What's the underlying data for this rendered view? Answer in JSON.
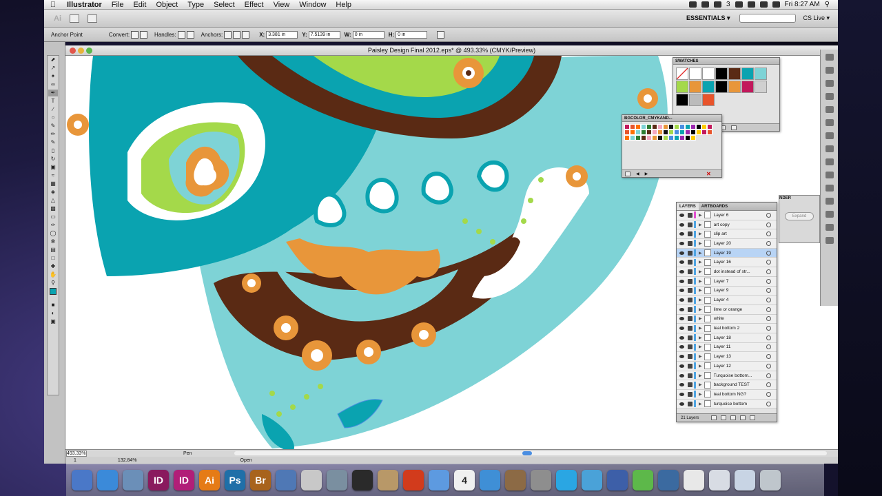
{
  "menubar": {
    "app_name": "Illustrator",
    "items": [
      "File",
      "Edit",
      "Object",
      "Type",
      "Select",
      "Effect",
      "View",
      "Window",
      "Help"
    ],
    "right": {
      "battery_label": "3",
      "clock": "Fri 8:27 AM"
    }
  },
  "appbar": {
    "logo": "Ai",
    "workspace": "ESSENTIALS ▾",
    "search_placeholder": "",
    "cs_live": "CS Live ▾"
  },
  "controlbar": {
    "mode_label": "Anchor Point",
    "convert_label": "Convert:",
    "handles_label": "Handles:",
    "anchors_label": "Anchors:",
    "x_label": "X:",
    "x_value": "3.381 in",
    "y_label": "Y:",
    "y_value": "7.5139 in",
    "w_label": "W:",
    "w_value": "0 in",
    "h_label": "H:",
    "h_value": "0 in"
  },
  "document": {
    "title": "Paisley Design Final 2012.eps* @ 493.33% (CMYK/Preview)",
    "zoom": "493.33%",
    "current_tool": "Pen",
    "bottom_zoom": "132.84%",
    "bottom_label": "Open",
    "page_number": "1"
  },
  "swatches_panel": {
    "title": "SWATCHES"
  },
  "bgcolor_panel": {
    "title": "BGCOLOR_CMYKAND..."
  },
  "behind_panel": {
    "tab_fragment": "NDER",
    "expand_label": "Expand"
  },
  "layers_panel": {
    "tabs": [
      "LAYERS",
      "ARTBOARDS"
    ],
    "layers": [
      {
        "name": "Layer 6",
        "color": "#e24fd0"
      },
      {
        "name": "art copy",
        "color": "#4fa4e2"
      },
      {
        "name": "clip art",
        "color": "#4fa4e2"
      },
      {
        "name": "Layer 20",
        "color": "#4fa4e2"
      },
      {
        "name": "Layer 19",
        "color": "#4fa4e2",
        "selected": true
      },
      {
        "name": "Layer 16",
        "color": "#4fa4e2"
      },
      {
        "name": "dot instead of str...",
        "color": "#4fa4e2"
      },
      {
        "name": "Layer 7",
        "color": "#4fa4e2"
      },
      {
        "name": "Layer 9",
        "color": "#4fa4e2"
      },
      {
        "name": "Layer 4",
        "color": "#4fa4e2"
      },
      {
        "name": "lime or orange",
        "color": "#4fa4e2"
      },
      {
        "name": "white",
        "color": "#4fa4e2"
      },
      {
        "name": "teal bottom 2",
        "color": "#4fa4e2"
      },
      {
        "name": "Layer 18",
        "color": "#4fa4e2"
      },
      {
        "name": "Layer 11",
        "color": "#4fa4e2"
      },
      {
        "name": "Layer 13",
        "color": "#4fa4e2"
      },
      {
        "name": "Layer 12",
        "color": "#4fa4e2"
      },
      {
        "name": "Turquoise bottom...",
        "color": "#4fa4e2"
      },
      {
        "name": "background TEST",
        "color": "#4fa4e2"
      },
      {
        "name": "teal bottom NG?",
        "color": "#4fa4e2"
      },
      {
        "name": "turquoise bottom",
        "color": "#4fa4e2"
      }
    ],
    "count_label": "21 Layers"
  },
  "dock": {
    "items": [
      {
        "name": "finder",
        "label": "",
        "color": "#4a78c8"
      },
      {
        "name": "safari",
        "label": "",
        "color": "#3b8ad9"
      },
      {
        "name": "preview",
        "label": "",
        "color": "#6b8fb8"
      },
      {
        "name": "indesign",
        "label": "ID",
        "color": "#8a1a5e"
      },
      {
        "name": "indesign-2",
        "label": "ID",
        "color": "#b11e78"
      },
      {
        "name": "illustrator",
        "label": "Ai",
        "color": "#e57b16"
      },
      {
        "name": "photoshop",
        "label": "Ps",
        "color": "#1f6fa8"
      },
      {
        "name": "bridge",
        "label": "Br",
        "color": "#a8631c"
      },
      {
        "name": "app-9",
        "label": "",
        "color": "#4f78b5"
      },
      {
        "name": "acrobat",
        "label": "",
        "color": "#c8c8c8"
      },
      {
        "name": "iphoto",
        "label": "",
        "color": "#7a8fa0"
      },
      {
        "name": "dashboard",
        "label": "",
        "color": "#2a2a2a"
      },
      {
        "name": "address",
        "label": "",
        "color": "#b89868"
      },
      {
        "name": "fire-app",
        "label": "",
        "color": "#d23b1c"
      },
      {
        "name": "ichat",
        "label": "",
        "color": "#5d9ae0"
      },
      {
        "name": "ical",
        "label": "4",
        "color": "#f0f0f0"
      },
      {
        "name": "itunes",
        "label": "",
        "color": "#3f8fd6"
      },
      {
        "name": "photos",
        "label": "",
        "color": "#8c6a45"
      },
      {
        "name": "system-prefs",
        "label": "",
        "color": "#8e8e8e"
      },
      {
        "name": "skype",
        "label": "",
        "color": "#2aa6e3"
      },
      {
        "name": "app-21",
        "label": "",
        "color": "#4aa2d8"
      },
      {
        "name": "bluetooth",
        "label": "",
        "color": "#3d5fa8"
      },
      {
        "name": "app-23",
        "label": "",
        "color": "#5db84a"
      },
      {
        "name": "app-24",
        "label": "",
        "color": "#3b6aa0"
      },
      {
        "name": "doc-1",
        "label": "",
        "color": "#e8e8e8"
      },
      {
        "name": "doc-2",
        "label": "",
        "color": "#d8dce4"
      },
      {
        "name": "doc-3",
        "label": "",
        "color": "#c8d4e4"
      },
      {
        "name": "trash",
        "label": "",
        "color": "#bfc6cc"
      }
    ]
  },
  "colors": {
    "teal": "#0aa3b0",
    "turquoise": "#7ed3d6",
    "brown": "#5a2a14",
    "orange": "#e8963a",
    "lime": "#a4d94a",
    "white": "#ffffff"
  }
}
